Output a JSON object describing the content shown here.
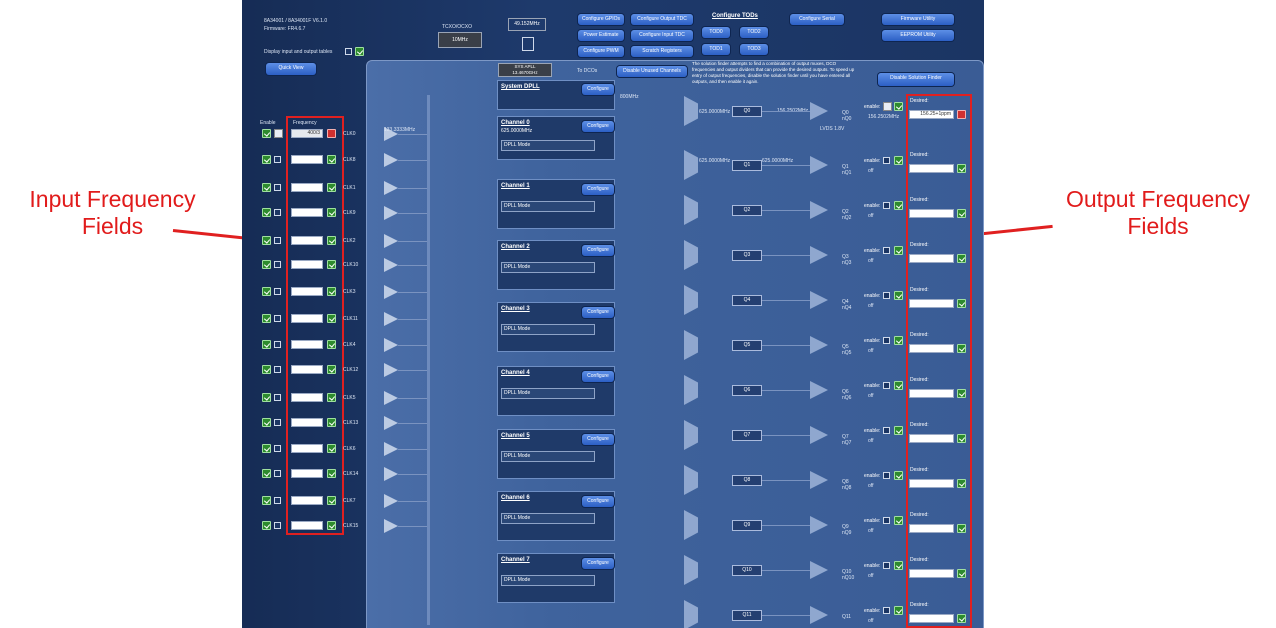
{
  "annotations": {
    "left_label": "Input Frequency\nFields",
    "right_label": "Output Frequency\nFields"
  },
  "header": {
    "device": "8A34001 / 8A34001F V6.1.0",
    "firmware": "Firmware: FR4.6.7",
    "display_tables": "Display input and output tables",
    "quick_view": "Quick View",
    "tcxo_label": "TCXO/OCXO",
    "tcxo_value": "10MHz",
    "xo_freq": "49.152MHz",
    "xo_label": "XO",
    "sys_apll": "SYS APLL",
    "sys_apll_freq": "13.4670GHz",
    "to_dcos": "To DCOs",
    "disable_unused": "Disable Unused Channels",
    "solution_text": "The solution finder attempts to find a combination of output muxes, DCO frequencies and output dividers that can provide the desired outputs. To speed up entry of output frequencies, disable the solution finder until you have entered all outputs, and then enable it again.",
    "disable_solution": "Disable Solution Finder"
  },
  "toolbar": {
    "configure_gpios": "Configure GPIOs",
    "configure_output_tdc": "Configure Output TDC",
    "configure_tods": "Configure TODs",
    "configure_serial": "Configure Serial",
    "firmware_utility": "Firmware Utility",
    "power_estimate": "Power Estimate",
    "configure_input_tdc": "Configure Input TDC",
    "tod0": "TOD0",
    "tod2": "TOD2",
    "eeprom_utility": "EEPROM Utility",
    "configure_pwm": "Configure PWM",
    "scratch_registers": "Scratch Registers",
    "tod1": "TOD1",
    "tod3": "TOD3"
  },
  "inputs": {
    "enable_header": "Enable",
    "frequency_header": "Frequency",
    "first_value": "400/3",
    "clk_labels": [
      "CLK0",
      "CLK8",
      "CLK1",
      "CLK9",
      "CLK2",
      "CLK10",
      "CLK3",
      "CLK11",
      "CLK4",
      "CLK12",
      "CLK5",
      "CLK13",
      "CLK6",
      "CLK14",
      "CLK7",
      "CLK15"
    ],
    "ref_freq": "133.3333MHz"
  },
  "system_dpll": {
    "title": "System DPLL",
    "configure": "Configure",
    "freq": "800MHz"
  },
  "channels": [
    {
      "title": "Channel 0",
      "freq": "625.0000MHz",
      "mode": "DPLL Mode",
      "configure": "Configure"
    },
    {
      "title": "Channel 1",
      "mode": "DPLL Mode",
      "configure": "Configure"
    },
    {
      "title": "Channel 2",
      "mode": "DPLL Mode",
      "configure": "Configure"
    },
    {
      "title": "Channel 3",
      "mode": "DPLL Mode",
      "configure": "Configure"
    },
    {
      "title": "Channel 4",
      "mode": "DPLL Mode",
      "configure": "Configure"
    },
    {
      "title": "Channel 5",
      "mode": "DPLL Mode",
      "configure": "Configure"
    },
    {
      "title": "Channel 6",
      "mode": "DPLL Mode",
      "configure": "Configure"
    },
    {
      "title": "Channel 7",
      "mode": "DPLL Mode",
      "configure": "Configure"
    }
  ],
  "outputs": {
    "q_labels": [
      "Q0",
      "Q1",
      "Q2",
      "Q3",
      "Q4",
      "Q5",
      "Q6",
      "Q7",
      "Q8",
      "Q9",
      "Q10",
      "Q11"
    ],
    "out_labels": [
      [
        "Q0",
        "nQ0"
      ],
      [
        "Q1",
        "nQ1"
      ],
      [
        "Q2",
        "nQ2"
      ],
      [
        "Q3",
        "nQ3"
      ],
      [
        "Q4",
        "nQ4"
      ],
      [
        "Q5",
        "nQ5"
      ],
      [
        "Q6",
        "nQ6"
      ],
      [
        "Q7",
        "nQ7"
      ],
      [
        "Q8",
        "nQ8"
      ],
      [
        "Q9",
        "nQ9"
      ],
      [
        "Q10",
        "nQ10"
      ],
      [
        "Q11",
        ""
      ]
    ],
    "row0_in": "625.0000MHz",
    "row0_out": "156.2502MHz",
    "row0_type": "LVDS 1.8V",
    "row0_result": "156.2502MHz",
    "row1_in": "625.0000MHz",
    "row1_out": "625.0000MHz",
    "enable_label": "enable:",
    "off_label": "off",
    "desired_label": "Desired:",
    "first_desired": "156.25+1ppm"
  }
}
